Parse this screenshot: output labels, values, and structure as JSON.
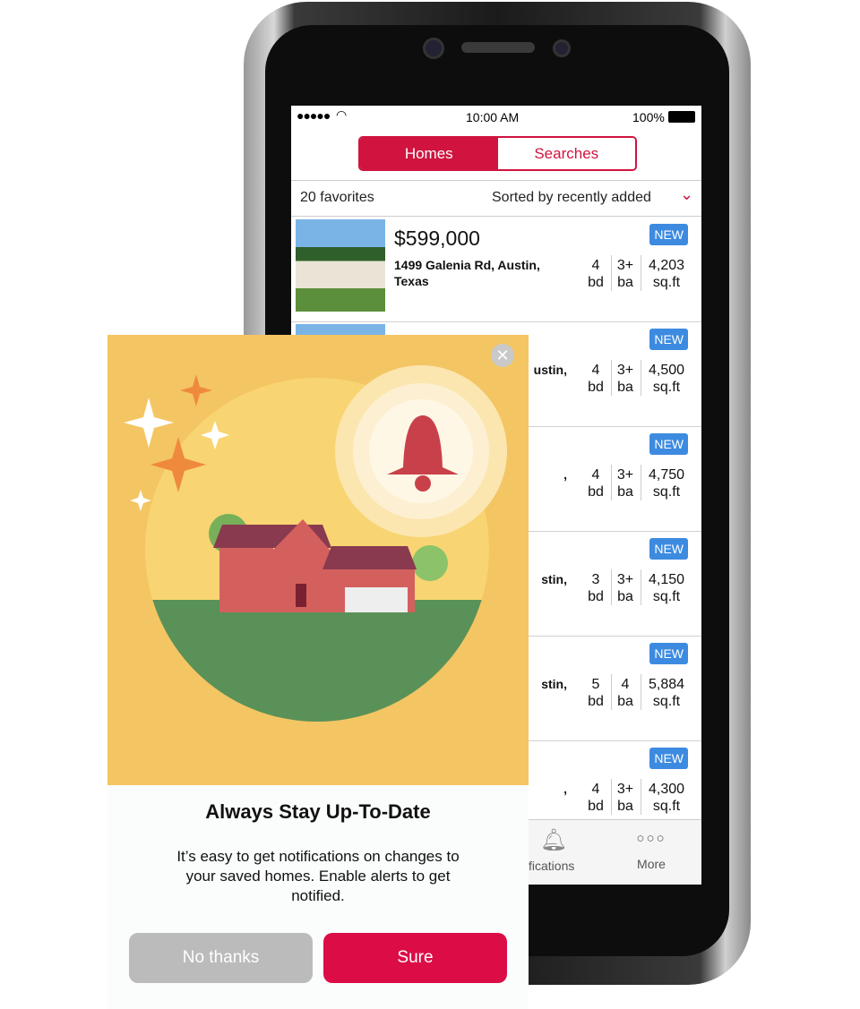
{
  "status_bar": {
    "signal": "●●●●●",
    "time": "10:00 AM",
    "battery": "100%"
  },
  "segmented": {
    "homes": "Homes",
    "searches": "Searches"
  },
  "sort_bar": {
    "count": "20 favorites",
    "sort": "Sorted by recently added"
  },
  "listings": [
    {
      "price": "$599,000",
      "address": "1499 Galenia Rd, Austin,",
      "address2": "Texas",
      "badge": "NEW",
      "bd": "4",
      "ba": "3+",
      "sqft": "4,203"
    },
    {
      "address": "ustin,",
      "badge": "NEW",
      "bd": "4",
      "ba": "3+",
      "sqft": "4,500"
    },
    {
      "address": ",",
      "badge": "NEW",
      "bd": "4",
      "ba": "3+",
      "sqft": "4,750"
    },
    {
      "address": "stin,",
      "badge": "NEW",
      "bd": "3",
      "ba": "3+",
      "sqft": "4,150"
    },
    {
      "address": "stin,",
      "badge": "NEW",
      "bd": "5",
      "ba": "4",
      "sqft": "5,884"
    },
    {
      "address": ",",
      "badge": "NEW",
      "bd": "4",
      "ba": "3+",
      "sqft": "4,300"
    }
  ],
  "units": {
    "bd": "bd",
    "ba": "ba",
    "sqft": "sq.ft"
  },
  "tab_bar": {
    "notifications": "tifications",
    "more": "More",
    "more_icon": "○○○"
  },
  "modal": {
    "close": "✕",
    "title": "Always Stay Up-To-Date",
    "body": "It’s easy to get notifications on changes to your saved homes. Enable alerts to get notified.",
    "no_thanks": "No thanks",
    "sure": "Sure"
  },
  "colors": {
    "brand_red": "#d0143f",
    "sure_button": "#dc0d46",
    "badge_blue": "#3d8be0",
    "illustration_bg": "#f4c563",
    "no_thanks_button": "#bbbbbb"
  }
}
